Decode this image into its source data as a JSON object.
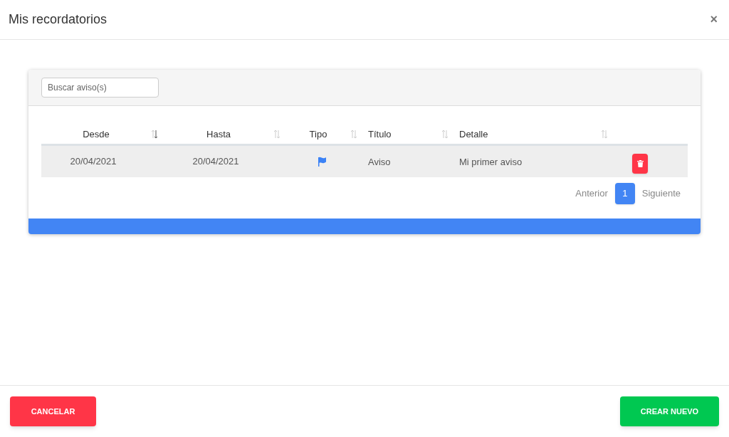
{
  "dialog": {
    "title": "Mis recordatorios",
    "close": "×"
  },
  "search": {
    "placeholder": "Buscar aviso(s)"
  },
  "table": {
    "columns": [
      {
        "label": "Desde",
        "kind": "centered",
        "sorted": true
      },
      {
        "label": "Hasta",
        "kind": "centered",
        "sorted": false
      },
      {
        "label": "Tipo",
        "kind": "centered",
        "sorted": false
      },
      {
        "label": "Título",
        "kind": "left",
        "sorted": false
      },
      {
        "label": "Detalle",
        "kind": "left",
        "sorted": false
      }
    ],
    "rows": [
      {
        "desde": "20/04/2021",
        "hasta": "20/04/2021",
        "kind": "flag",
        "titulo": "Aviso",
        "detalle": "Mi primer aviso",
        "selected": true
      }
    ]
  },
  "pagination": {
    "previous": "Anterior",
    "pages": [
      {
        "label": "1",
        "selected": true
      }
    ],
    "next": "Siguiente"
  },
  "buttons": {
    "cancel": "CANCELAR",
    "create": "CREAR NUEVO"
  }
}
